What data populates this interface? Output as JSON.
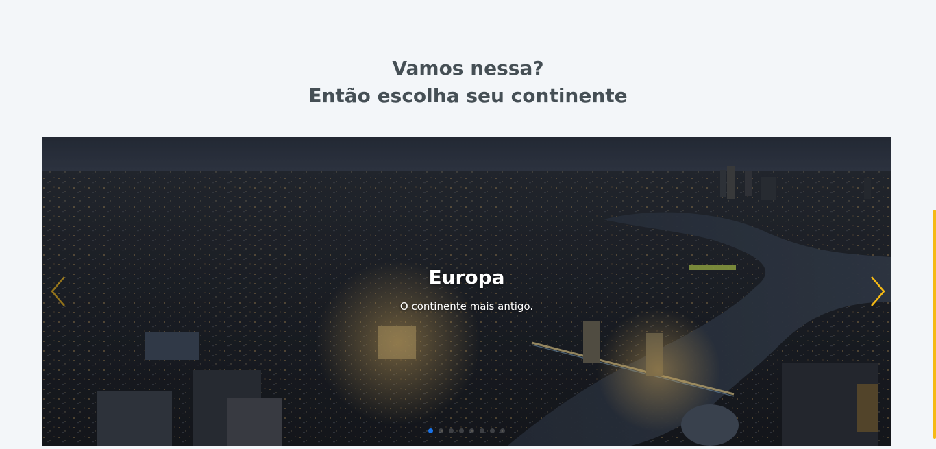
{
  "heading": {
    "line1": "Vamos nessa?",
    "line2": "Então escolha seu continente"
  },
  "carousel": {
    "active_index": 0,
    "slide_count": 8,
    "slides": [
      {
        "title": "Europa",
        "text": "O continente mais antigo."
      }
    ],
    "prev_icon": "chevron-left-icon",
    "next_icon": "chevron-right-icon",
    "arrow_color": "#f5b914",
    "active_dot_color": "#1a73e8"
  },
  "scrollbar": {
    "color": "#f5b914"
  }
}
